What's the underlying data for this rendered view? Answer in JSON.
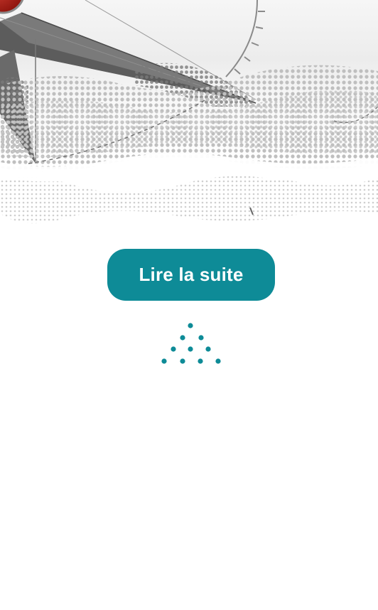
{
  "cta": {
    "label": "Lire la suite"
  },
  "hero": {
    "image": "compass-halftone-illustration"
  },
  "decor": {
    "icon": "dots-triangle-icon"
  },
  "colors": {
    "accent": "#0e8b97",
    "compass_red": "#b11a12",
    "halftone_grey": "#bdbdbd",
    "needle_grey": "#5c5c5c"
  }
}
